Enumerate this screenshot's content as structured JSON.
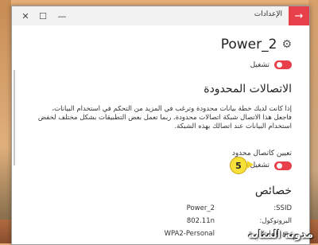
{
  "window": {
    "title": "الإعدادات",
    "back_icon": "arrow-right",
    "accent": "#e8404a"
  },
  "header": {
    "network_name": "Power_2",
    "settings_icon": "gear"
  },
  "connect_toggle": {
    "state": "on",
    "label": "تشغيل"
  },
  "metered": {
    "title": "الاتصالات المحدودة",
    "description": "إذا كانت لديك خطة بيانات محدودة وترغب في المزيد من التحكم في استخدام البيانات، فاجعل هذا الاتصال شبكة اتصالات محدودة. ربما تعمل بعض التطبيقات بشكل مختلف لخفض استخدام البيانات عند اتصالك بهذه الشبكة.",
    "setting_label": "تعيين كاتصال محدود",
    "toggle_state": "on",
    "toggle_label": "تشغيل",
    "step_badge": "5"
  },
  "properties": {
    "title": "خصائص",
    "rows": [
      {
        "label": "SSID:",
        "value": "Power_2"
      },
      {
        "label": "البروتوكول:",
        "value": "802.11n"
      },
      {
        "label": "نوع الأمان:",
        "value": "WPA2-Personal"
      }
    ]
  },
  "watermark": "مدونة المثابة"
}
